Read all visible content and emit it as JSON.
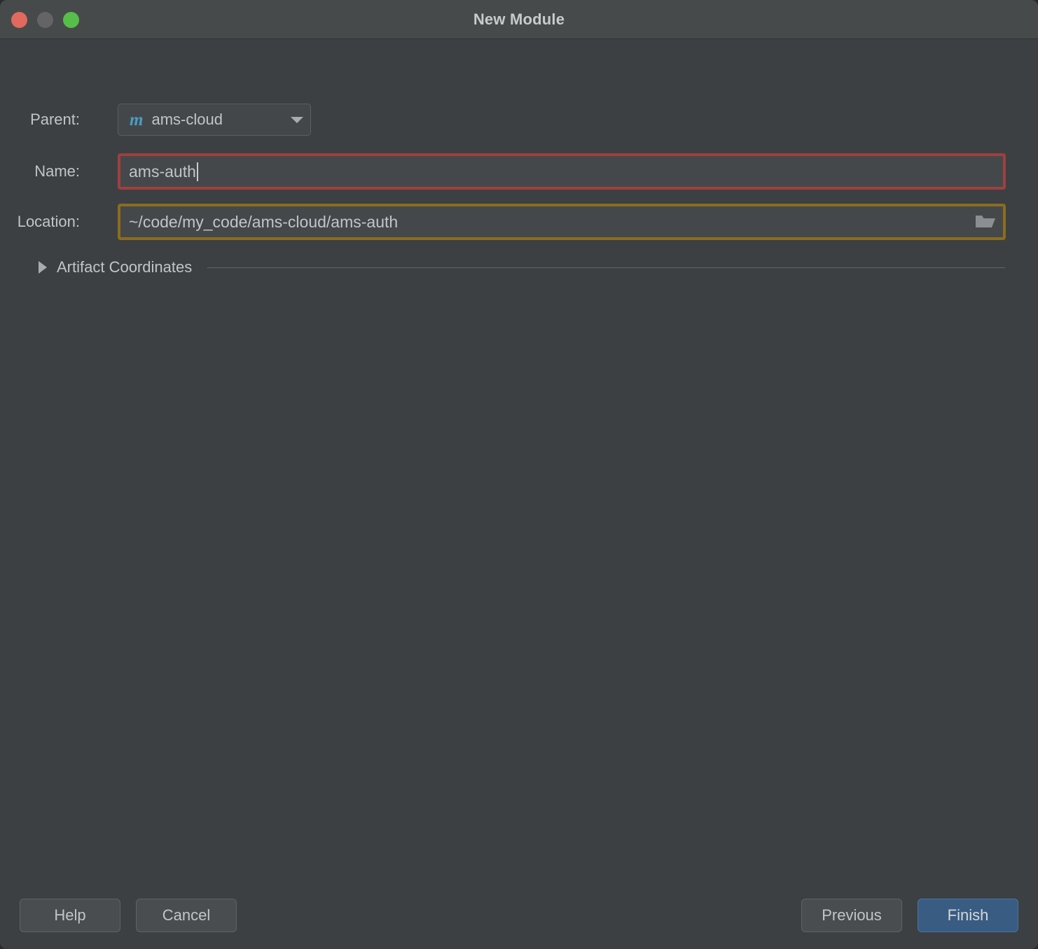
{
  "window": {
    "title": "New Module",
    "traffic_lights": [
      {
        "name": "close",
        "color": "#e1695e"
      },
      {
        "name": "minimize",
        "color": "#646464"
      },
      {
        "name": "maximize",
        "color": "#56bf4a"
      }
    ]
  },
  "form": {
    "parent": {
      "label": "Parent:",
      "icon": "maven-m-icon",
      "icon_glyph": "m",
      "icon_color": "#4a9ec4",
      "value": "ams-cloud"
    },
    "name": {
      "label": "Name:",
      "value": "ams-auth",
      "placeholder": "",
      "border_color": "#9e4040",
      "focused": "true"
    },
    "location": {
      "label": "Location:",
      "value": "~/code/my_code/ams-cloud/ams-auth",
      "placeholder": "",
      "border_color": "#8a6d1e",
      "browse_icon": "folder-icon"
    }
  },
  "artifact_coordinates": {
    "label": "Artifact Coordinates",
    "expanded": "false",
    "arrow_icon": "chevron-right-icon"
  },
  "footer": {
    "help_label": "Help",
    "cancel_label": "Cancel",
    "previous_label": "Previous",
    "finish_label": "Finish",
    "primary_color": "#395c83"
  }
}
